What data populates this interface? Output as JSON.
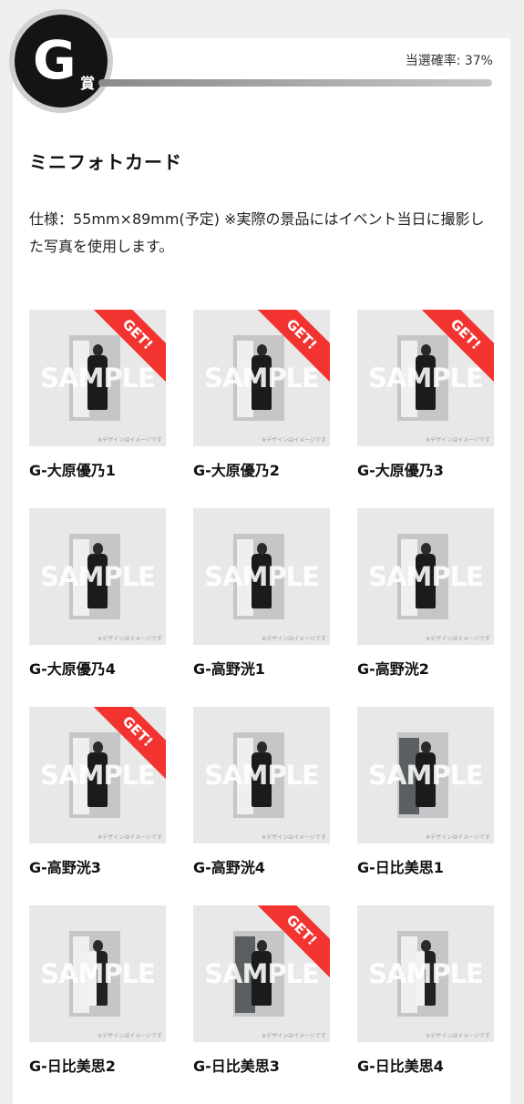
{
  "prize": {
    "letter": "G",
    "suffix": "賞",
    "rate_text": "当選確率: 37%",
    "name": "ミニフォトカード",
    "spec": "仕様：55mm×89mm(予定) ※実際の景品にはイベント当日に撮影した写真を使用します。"
  },
  "card_common": {
    "sample_text": "SAMPLE",
    "note_text": "※デザインはイメージです",
    "get_text": "GET!"
  },
  "cards": [
    {
      "label": "G-大原優乃1",
      "get": true
    },
    {
      "label": "G-大原優乃2",
      "get": true
    },
    {
      "label": "G-大原優乃3",
      "get": true
    },
    {
      "label": "G-大原優乃4",
      "get": false
    },
    {
      "label": "G-高野洸1",
      "get": false
    },
    {
      "label": "G-高野洸2",
      "get": false
    },
    {
      "label": "G-高野洸3",
      "get": true
    },
    {
      "label": "G-高野洸4",
      "get": false
    },
    {
      "label": "G-日比美思1",
      "get": false
    },
    {
      "label": "G-日比美思2",
      "get": false
    },
    {
      "label": "G-日比美思3",
      "get": true
    },
    {
      "label": "G-日比美思4",
      "get": false
    }
  ]
}
